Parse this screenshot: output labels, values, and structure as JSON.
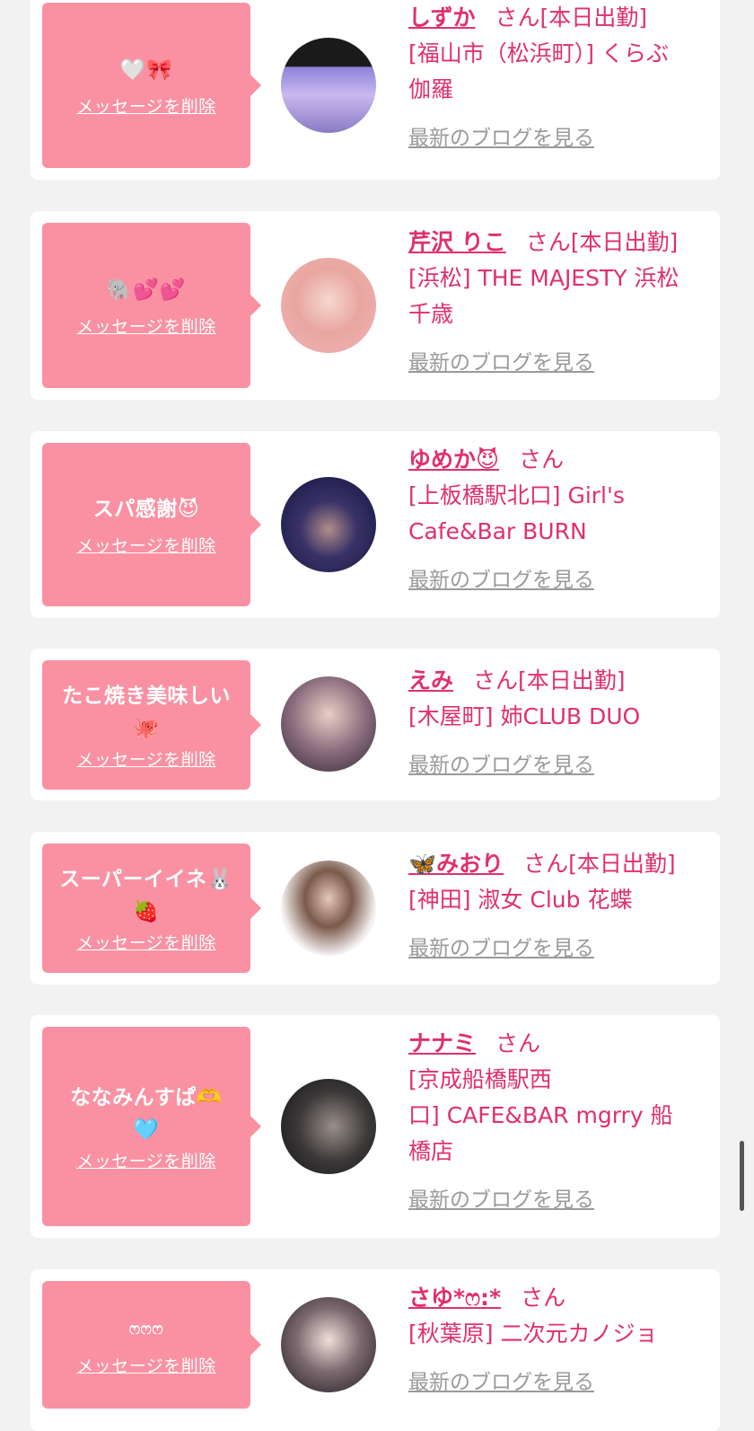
{
  "colors": {
    "background": "#f2f2f2",
    "card": "#ffffff",
    "bubble": "#fa91a2",
    "name_pink": "#e0306a",
    "blog_gray": "#9a9a9a"
  },
  "delete_label": "メッセージを削除",
  "blog_label": "最新のブログを見る",
  "san_label": "さん",
  "cards": [
    {
      "message_lines": [
        "🤍🎀"
      ],
      "name": "しずか",
      "status": "[本日出勤]",
      "shop_lines": [
        "[福山市（松浜町）] くらぶ",
        "伽羅"
      ]
    },
    {
      "message_lines": [
        "🐘💕💕"
      ],
      "name": "芹沢 りこ",
      "status": "[本日出勤]",
      "shop_lines": [
        "[浜松] THE MAJESTY 浜松",
        "千歳"
      ]
    },
    {
      "message_lines": [
        "スパ感謝😈"
      ],
      "name": "ゆめか😈",
      "status": "",
      "shop_lines": [
        "[上板橋駅北口] Girl's",
        "Cafe&Bar BURN"
      ]
    },
    {
      "message_lines": [
        "たこ焼き美味しい",
        "🐙"
      ],
      "name": "えみ",
      "status": "[本日出勤]",
      "shop_lines": [
        "[木屋町] 姉CLUB DUO"
      ]
    },
    {
      "message_lines": [
        "スーパーイイネ🐰",
        "🍓"
      ],
      "name": "🦋みおり",
      "status": "[本日出勤]",
      "shop_lines": [
        "[神田] 淑女 Club 花蝶"
      ]
    },
    {
      "message_lines": [
        "ななみんすぱ🫶",
        "🩵"
      ],
      "name": "ナナミ",
      "status": "",
      "shop_lines": [
        "[京成船橋駅西",
        "口] CAFE&BAR mgrry 船",
        "橋店"
      ]
    },
    {
      "message_lines": [
        "ෆෆෆ"
      ],
      "name": "さゆ*ෆ:*",
      "status": "",
      "shop_lines": [
        "[秋葉原] 二次元カノジョ"
      ]
    }
  ]
}
